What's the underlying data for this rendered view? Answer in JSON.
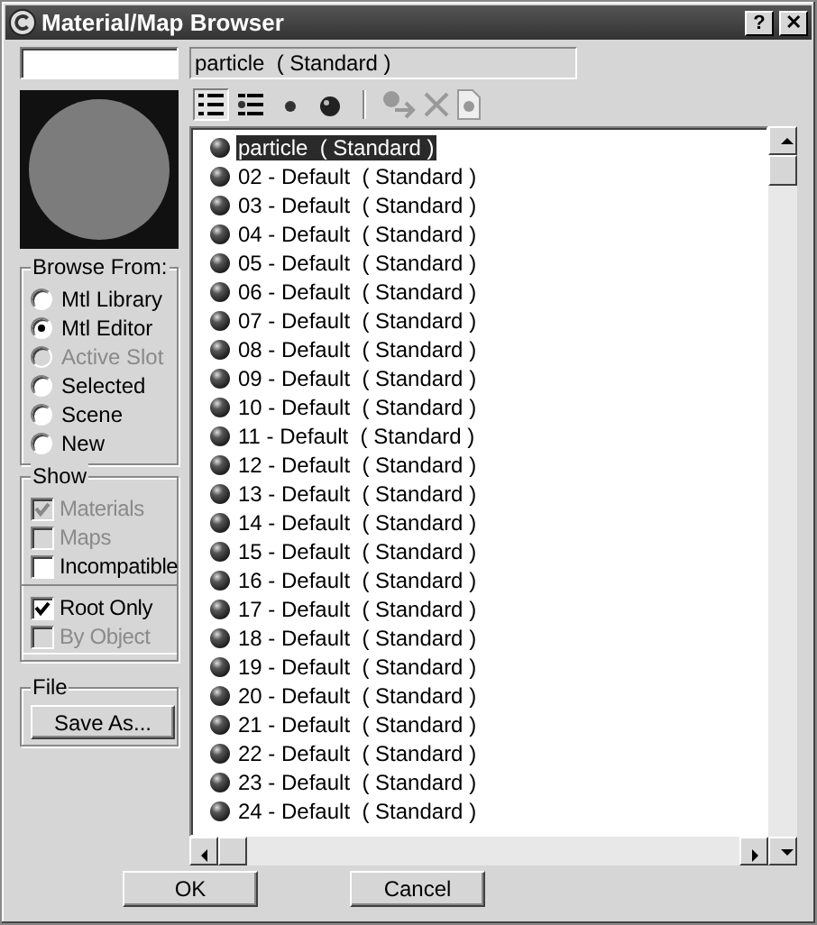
{
  "window": {
    "title": "Material/Map Browser",
    "help_button": "?",
    "close_button": "✕"
  },
  "current_name": "particle  ( Standard )",
  "view_buttons": [
    {
      "kind": "list",
      "selected": true
    },
    {
      "kind": "list-icons",
      "selected": false
    },
    {
      "kind": "small-icons",
      "selected": false
    },
    {
      "kind": "large-icons",
      "selected": false
    }
  ],
  "browse_from": {
    "title": "Browse From:",
    "options": [
      {
        "label": "Mtl Library",
        "selected": false,
        "disabled": false
      },
      {
        "label": "Mtl Editor",
        "selected": true,
        "disabled": false
      },
      {
        "label": "Active Slot",
        "selected": false,
        "disabled": true
      },
      {
        "label": "Selected",
        "selected": false,
        "disabled": false
      },
      {
        "label": "Scene",
        "selected": false,
        "disabled": false
      },
      {
        "label": "New",
        "selected": false,
        "disabled": false
      }
    ]
  },
  "show": {
    "title": "Show",
    "options": [
      {
        "label": "Materials",
        "checked": true,
        "disabled": true
      },
      {
        "label": "Maps",
        "checked": false,
        "disabled": true
      },
      {
        "label": "Incompatible",
        "checked": false,
        "disabled": false
      }
    ],
    "filters": [
      {
        "label": "Root Only",
        "checked": true,
        "disabled": false
      },
      {
        "label": "By Object",
        "checked": false,
        "disabled": true
      }
    ]
  },
  "file": {
    "title": "File",
    "button": "Save As..."
  },
  "materials": [
    {
      "label": "particle  ( Standard )",
      "selected": true
    },
    {
      "label": "02 - Default  ( Standard )",
      "selected": false
    },
    {
      "label": "03 - Default  ( Standard )",
      "selected": false
    },
    {
      "label": "04 - Default  ( Standard )",
      "selected": false
    },
    {
      "label": "05 - Default  ( Standard )",
      "selected": false
    },
    {
      "label": "06 - Default  ( Standard )",
      "selected": false
    },
    {
      "label": "07 - Default  ( Standard )",
      "selected": false
    },
    {
      "label": "08 - Default  ( Standard )",
      "selected": false
    },
    {
      "label": "09 - Default  ( Standard )",
      "selected": false
    },
    {
      "label": "10 - Default  ( Standard )",
      "selected": false
    },
    {
      "label": "11 - Default  ( Standard )",
      "selected": false
    },
    {
      "label": "12 - Default  ( Standard )",
      "selected": false
    },
    {
      "label": "13 - Default  ( Standard )",
      "selected": false
    },
    {
      "label": "14 - Default  ( Standard )",
      "selected": false
    },
    {
      "label": "15 - Default  ( Standard )",
      "selected": false
    },
    {
      "label": "16 - Default  ( Standard )",
      "selected": false
    },
    {
      "label": "17 - Default  ( Standard )",
      "selected": false
    },
    {
      "label": "18 - Default  ( Standard )",
      "selected": false
    },
    {
      "label": "19 - Default  ( Standard )",
      "selected": false
    },
    {
      "label": "20 - Default  ( Standard )",
      "selected": false
    },
    {
      "label": "21 - Default  ( Standard )",
      "selected": false
    },
    {
      "label": "22 - Default  ( Standard )",
      "selected": false
    },
    {
      "label": "23 - Default  ( Standard )",
      "selected": false
    },
    {
      "label": "24 - Default  ( Standard )",
      "selected": false
    }
  ],
  "buttons": [
    "OK",
    "Cancel"
  ]
}
